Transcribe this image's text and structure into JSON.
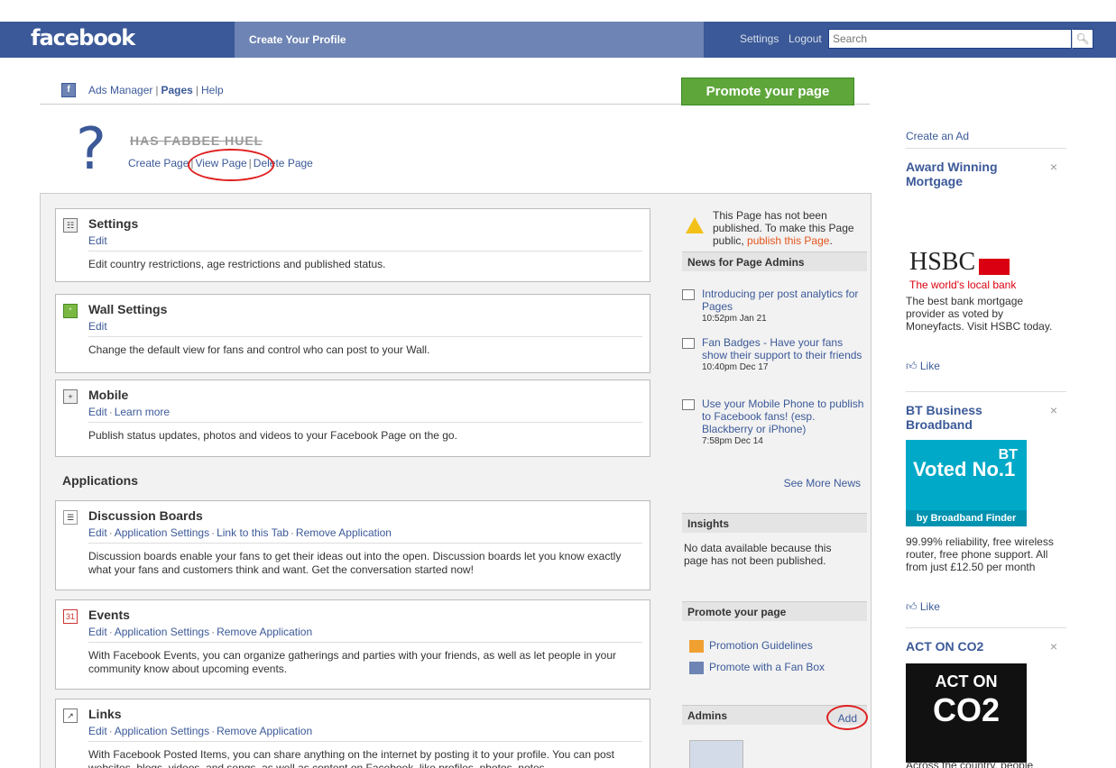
{
  "header": {
    "logo": "facebook",
    "title": "Create Your Profile",
    "settings": "Settings",
    "logout": "Logout",
    "search_placeholder": "Search"
  },
  "subnav": {
    "ads_manager": "Ads Manager",
    "pages": "Pages",
    "help": "Help",
    "sep": "|",
    "promote": "Promote your page"
  },
  "page": {
    "name": "HAS FABBEE HUEL",
    "create": "Create Page",
    "view": "View Page",
    "delete": "Delete Page",
    "sep": "|"
  },
  "cards": [
    {
      "title": "Settings",
      "links": [
        "Edit"
      ],
      "desc": "Edit country restrictions, age restrictions and published status."
    },
    {
      "title": "Wall Settings",
      "links": [
        "Edit"
      ],
      "desc": "Change the default view for fans and control who can post to your Wall."
    },
    {
      "title": "Mobile",
      "links": [
        "Edit",
        "Learn more"
      ],
      "desc": "Publish status updates, photos and videos to your Facebook Page on the go."
    }
  ],
  "applications_heading": "Applications",
  "apps": [
    {
      "title": "Discussion Boards",
      "links": [
        "Edit",
        "Application Settings",
        "Link to this Tab",
        "Remove Application"
      ],
      "desc": "Discussion boards enable your fans to get their ideas out into the open. Discussion boards let you know exactly what your fans and customers think and want. Get the conversation started now!"
    },
    {
      "title": "Events",
      "links": [
        "Edit",
        "Application Settings",
        "Remove Application"
      ],
      "desc": "With Facebook Events, you can organize gatherings and parties with your friends, as well as let people in your community know about upcoming events."
    },
    {
      "title": "Links",
      "links": [
        "Edit",
        "Application Settings",
        "Remove Application"
      ],
      "desc": "With Facebook Posted Items, you can share anything on the internet by posting it to your profile. You can post websites, blogs, videos, and songs, as well as content on Facebook, like profiles, photos, notes"
    }
  ],
  "right": {
    "warning_pre": "This Page has not been published. To make this Page public,",
    "warning_link": "publish this Page",
    "warning_post": ".",
    "news_heading": "News for Page Admins",
    "news": [
      {
        "text": "Introducing per post analytics for Pages",
        "time": "10:52pm Jan 21"
      },
      {
        "text": "Fan Badges - Have your fans show their support to their friends",
        "time": "10:40pm Dec 17"
      },
      {
        "text": "Use your Mobile Phone to publish to Facebook fans! (esp. Blackberry or iPhone)",
        "time": "7:58pm Dec 14"
      }
    ],
    "see_more": "See More News",
    "insights_heading": "Insights",
    "insights_text": "No data available because this page has not been published.",
    "promote_heading": "Promote your page",
    "promo_guidelines": "Promotion Guidelines",
    "promo_fanbox": "Promote with a Fan Box",
    "admins_heading": "Admins",
    "admins_add": "Add"
  },
  "sidebar": {
    "create_ad": "Create an Ad",
    "close": "×",
    "like": "Like",
    "ads": [
      {
        "title": "Award Winning Mortgage",
        "logo": "HSBC",
        "tagline": "The world's local bank",
        "body": "The best bank mortgage provider as voted by Moneyfacts. Visit HSBC today."
      },
      {
        "title": "BT Business Broadband",
        "img_big": "Voted No.1",
        "img_bt": "BT",
        "img_bottom": "by Broadband Finder",
        "body": "99.99% reliability, free wireless router, free phone support. All from just £12.50 per month"
      },
      {
        "title": "ACT ON CO2",
        "img_line1": "ACT ON",
        "img_line2": "CO2",
        "body": "Across the country, people"
      }
    ]
  }
}
